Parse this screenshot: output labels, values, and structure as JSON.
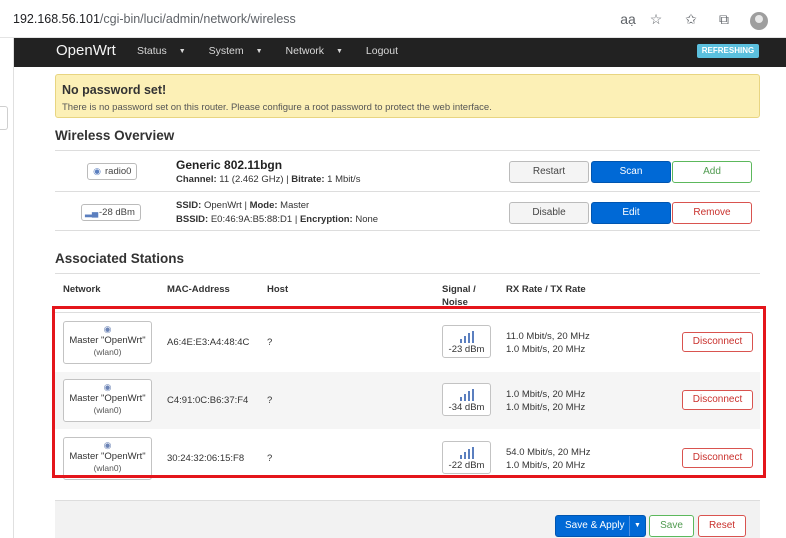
{
  "browser": {
    "url_host": "192.168.56.101",
    "url_path": "/cgi-bin/luci/admin/network/wireless",
    "icons": [
      "read-aloud-icon",
      "star-icon",
      "favorites-icon",
      "collections-icon",
      "profile-icon"
    ]
  },
  "header": {
    "brand": "OpenWrt",
    "nav": [
      "Status",
      "System",
      "Network",
      "Logout"
    ],
    "status_badge": "REFRESHING"
  },
  "alert": {
    "title": "No password set!",
    "text": "There is no password set on this router. Please configure a root password to protect the web interface."
  },
  "overview": {
    "title": "Wireless Overview",
    "device": {
      "badge": "radio0",
      "name": "Generic 802.11bgn",
      "channel_label": "Channel:",
      "channel_value": " 11 (2.462 GHz) | ",
      "bitrate_label": "Bitrate:",
      "bitrate_value": " 1 Mbit/s",
      "buttons": [
        "Restart",
        "Scan",
        "Add"
      ]
    },
    "network": {
      "badge": "-28 dBm",
      "ssid_label": "SSID:",
      "ssid_value": " OpenWrt | ",
      "mode_label": "Mode:",
      "mode_value": " Master",
      "bssid_label": "BSSID:",
      "bssid_value": " E0:46:9A:B5:88:D1 | ",
      "enc_label": "Encryption:",
      "enc_value": " None",
      "buttons": [
        "Disable",
        "Edit",
        "Remove"
      ]
    }
  },
  "stations": {
    "title": "Associated Stations",
    "columns": [
      "Network",
      "MAC-Address",
      "Host",
      "Signal /",
      "Noise",
      "RX Rate / TX Rate"
    ],
    "rows": [
      {
        "net_line1": "Master \"OpenWrt\"",
        "net_line2": "(wlan0)",
        "mac": "A6:4E:E3:A4:48:4C",
        "host": "?",
        "signal": "-23 dBm",
        "rx": "11.0 Mbit/s, 20 MHz",
        "tx": "1.0 Mbit/s, 20 MHz",
        "action": "Disconnect"
      },
      {
        "net_line1": "Master \"OpenWrt\"",
        "net_line2": "(wlan0)",
        "mac": "C4:91:0C:B6:37:F4",
        "host": "?",
        "signal": "-34 dBm",
        "rx": "1.0 Mbit/s, 20 MHz",
        "tx": "1.0 Mbit/s, 20 MHz",
        "action": "Disconnect"
      },
      {
        "net_line1": "Master \"OpenWrt\"",
        "net_line2": "(wlan0)",
        "mac": "30:24:32:06:15:F8",
        "host": "?",
        "signal": "-22 dBm",
        "rx": "54.0 Mbit/s, 20 MHz",
        "tx": "1.0 Mbit/s, 20 MHz",
        "action": "Disconnect"
      }
    ]
  },
  "footer": {
    "save_apply": "Save & Apply",
    "save": "Save",
    "reset": "Reset"
  },
  "colors": {
    "primary": "#0069d6",
    "success": "#5cb85c",
    "danger": "#d9534f",
    "highlight": "#e4151b",
    "header_bg": "#222222",
    "alert_bg": "#fcf0b6"
  }
}
